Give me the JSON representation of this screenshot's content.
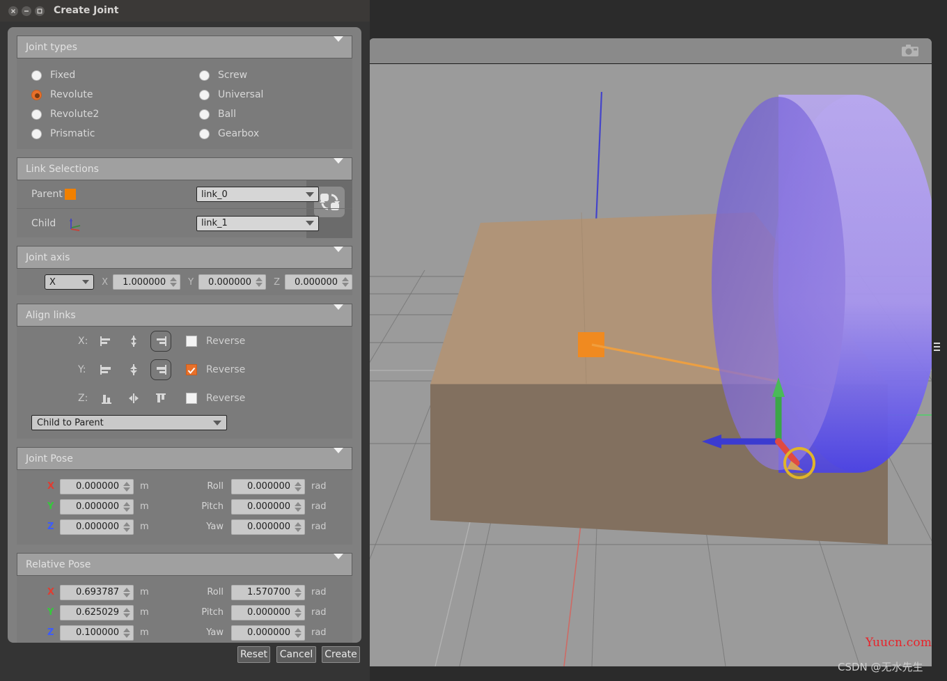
{
  "window": {
    "title": "Create Joint",
    "controls": [
      "close",
      "minimize",
      "maximize"
    ]
  },
  "sections": {
    "joint_types": {
      "header": "Joint types",
      "options_left": [
        "Fixed",
        "Revolute",
        "Revolute2",
        "Prismatic"
      ],
      "options_right": [
        "Screw",
        "Universal",
        "Ball",
        "Gearbox"
      ],
      "selected": "Revolute"
    },
    "link_selections": {
      "header": "Link Selections",
      "parent_label": "Parent",
      "parent_value": "link_0",
      "child_label": "Child",
      "child_value": "link_1",
      "parent_swatch_color": "#f08000",
      "swap_button": "swap-links-button"
    },
    "joint_axis": {
      "header": "Joint axis",
      "preset": "X",
      "x_label": "X",
      "x_value": "1.000000",
      "y_label": "Y",
      "y_value": "0.000000",
      "z_label": "Z",
      "z_value": "0.000000"
    },
    "align_links": {
      "header": "Align links",
      "rows": [
        {
          "axis": "X:",
          "reverse_label": "Reverse",
          "reverse_checked": false,
          "selected_index": 2
        },
        {
          "axis": "Y:",
          "reverse_label": "Reverse",
          "reverse_checked": true,
          "selected_index": 2
        },
        {
          "axis": "Z:",
          "reverse_label": "Reverse",
          "reverse_checked": false,
          "selected_index": -1
        }
      ],
      "direction": "Child to Parent"
    },
    "joint_pose": {
      "header": "Joint Pose",
      "pos": [
        {
          "axis": "X",
          "value": "0.000000",
          "unit": "m"
        },
        {
          "axis": "Y",
          "value": "0.000000",
          "unit": "m"
        },
        {
          "axis": "Z",
          "value": "0.000000",
          "unit": "m"
        }
      ],
      "rot": [
        {
          "label": "Roll",
          "value": "0.000000",
          "unit": "rad"
        },
        {
          "label": "Pitch",
          "value": "0.000000",
          "unit": "rad"
        },
        {
          "label": "Yaw",
          "value": "0.000000",
          "unit": "rad"
        }
      ]
    },
    "relative_pose": {
      "header": "Relative Pose",
      "pos": [
        {
          "axis": "X",
          "value": "0.693787",
          "unit": "m"
        },
        {
          "axis": "Y",
          "value": "0.625029",
          "unit": "m"
        },
        {
          "axis": "Z",
          "value": "0.100000",
          "unit": "m"
        }
      ],
      "rot": [
        {
          "label": "Roll",
          "value": "1.570700",
          "unit": "rad"
        },
        {
          "label": "Pitch",
          "value": "0.000000",
          "unit": "rad"
        },
        {
          "label": "Yaw",
          "value": "0.000000",
          "unit": "rad"
        }
      ]
    }
  },
  "buttons": {
    "reset": "Reset",
    "cancel": "Cancel",
    "create": "Create"
  },
  "viewport": {
    "camera_icon": "camera-icon",
    "watermark_red": "Yuucn.com",
    "watermark_grey": "CSDN @无水先生",
    "colors": {
      "ground": "#9b9b9b",
      "box_top": "#b09478",
      "box_front": "#82705f",
      "cylinder": "#8f7fe8",
      "marker": "#f08a20",
      "axis_red": "#e03c31",
      "axis_green": "#35c93b",
      "axis_blue": "#3b3bd0"
    }
  },
  "accent": "#e8702a"
}
